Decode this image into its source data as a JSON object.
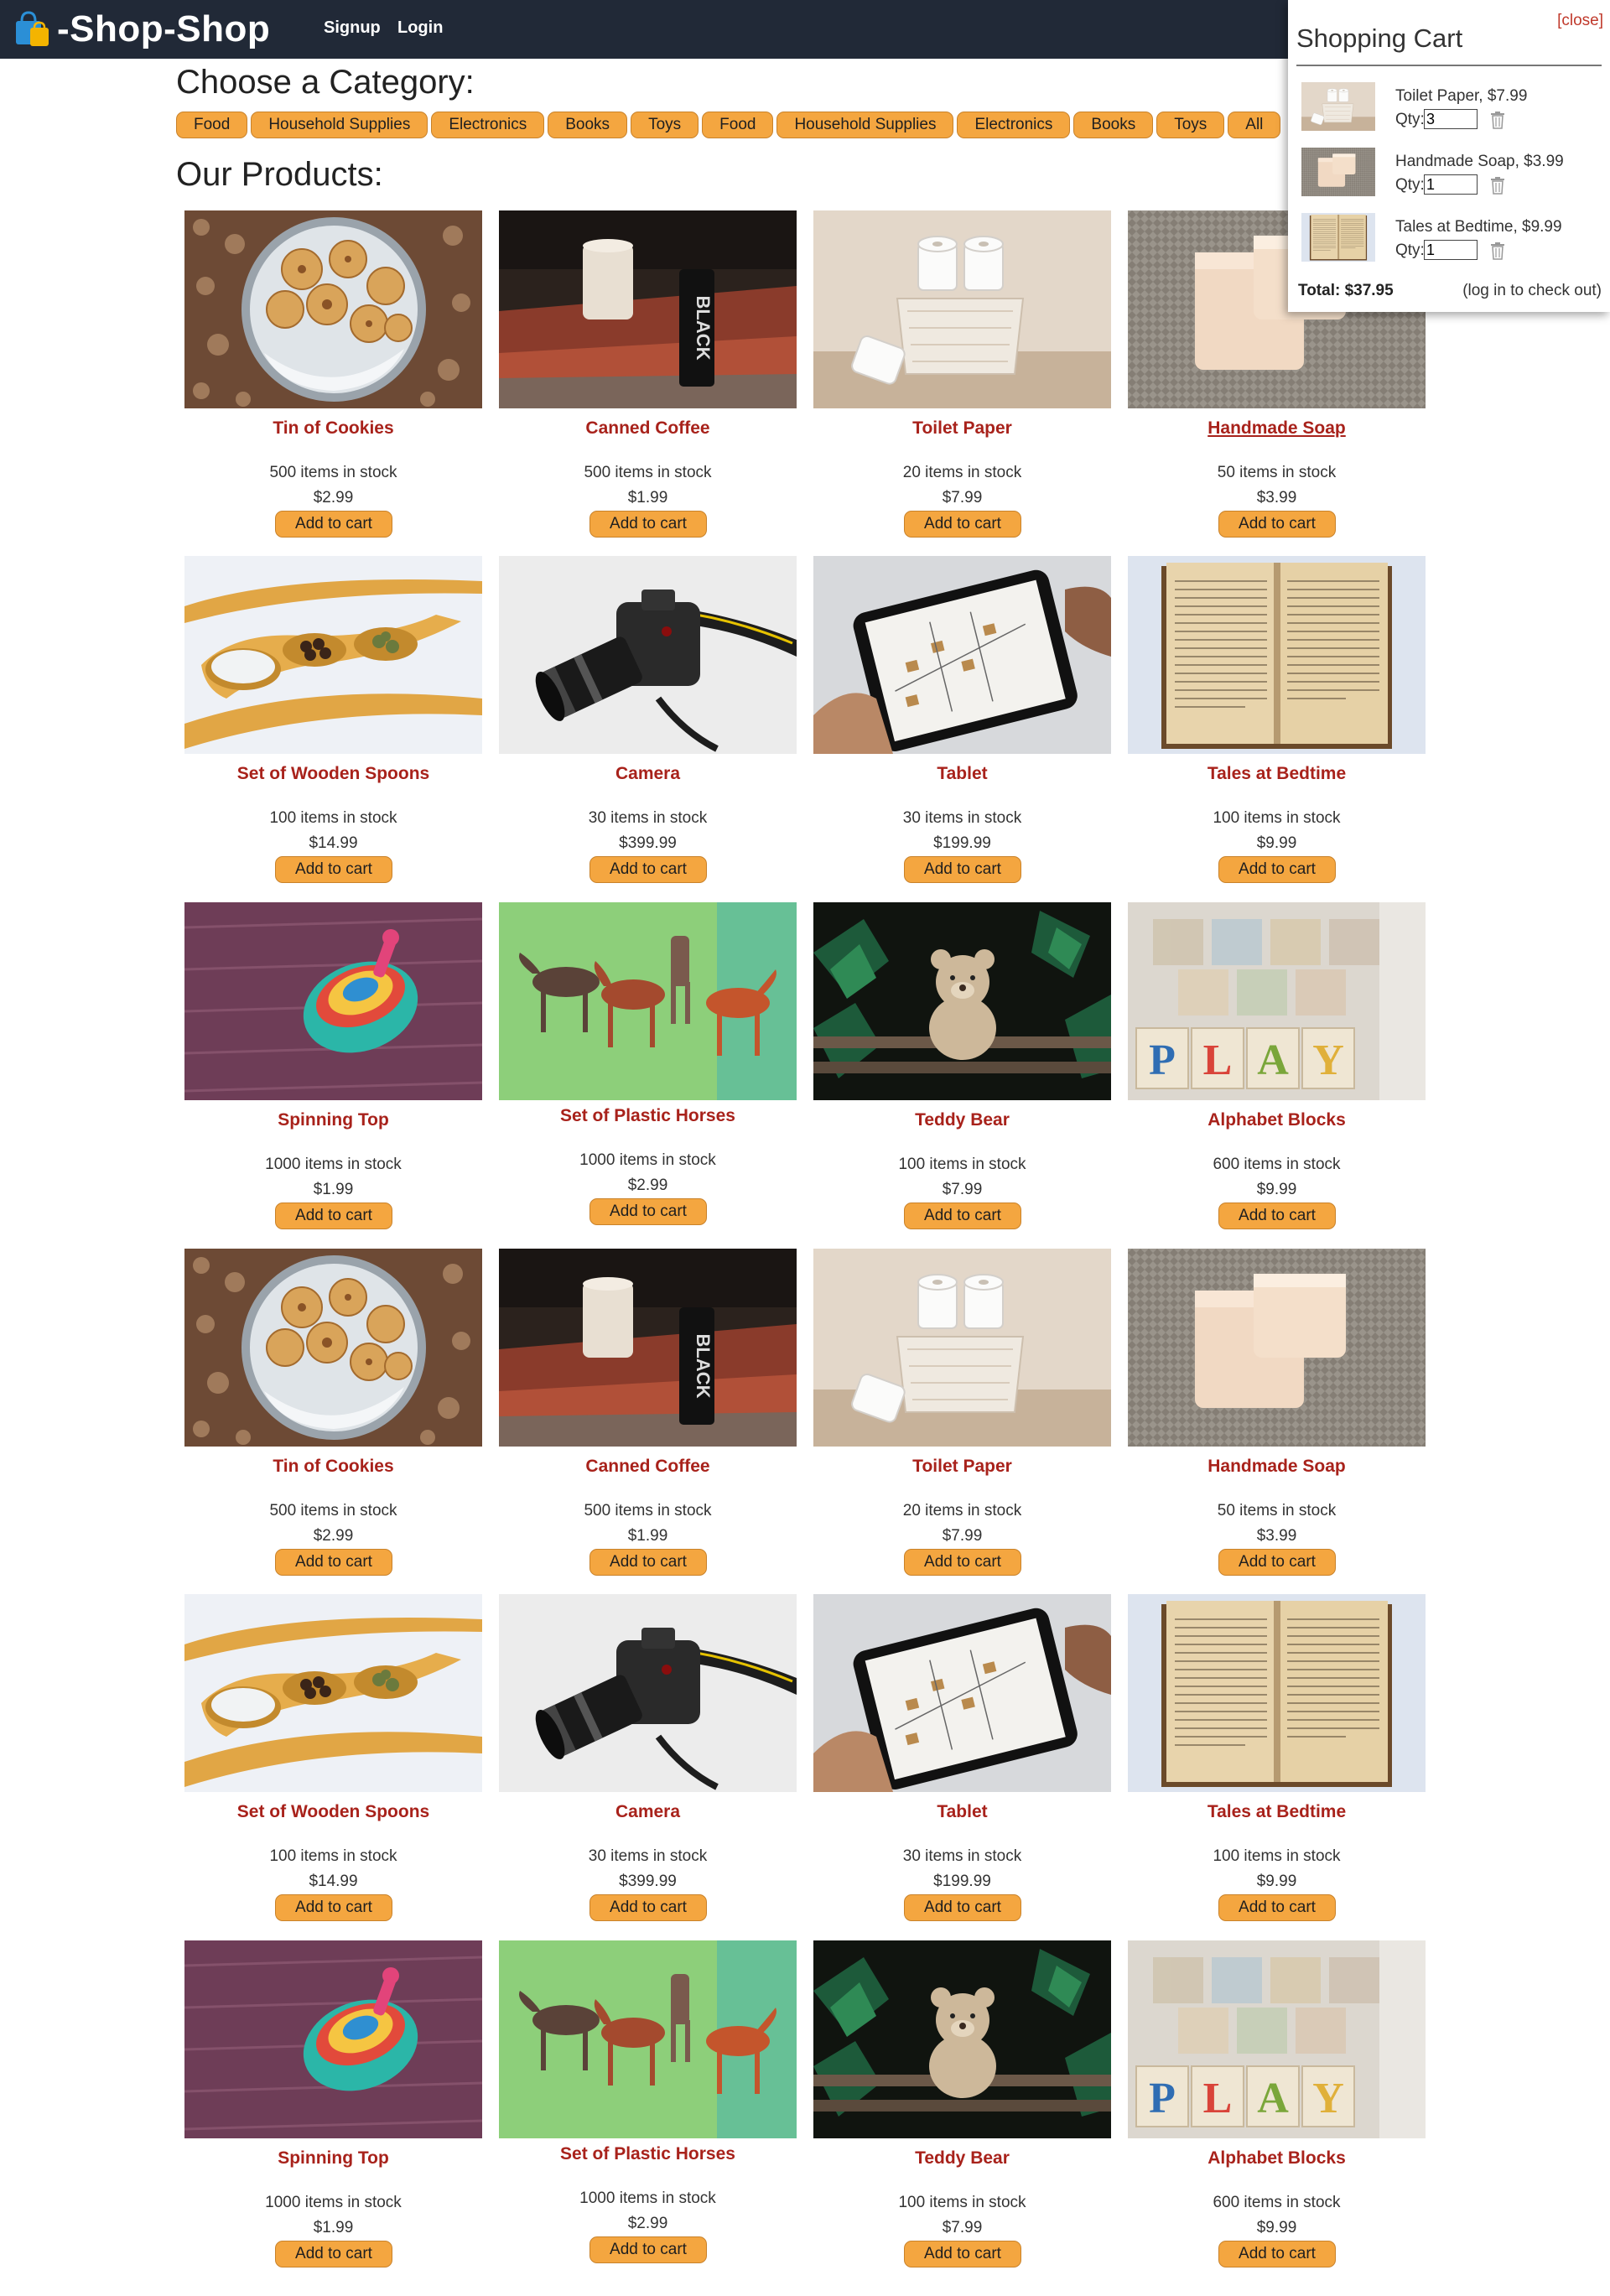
{
  "brand": {
    "name": "-Shop-Shop"
  },
  "nav": {
    "signup": "Signup",
    "login": "Login"
  },
  "headings": {
    "categories": "Choose a Category:",
    "products": "Our Products:"
  },
  "categories": [
    "Food",
    "Household Supplies",
    "Electronics",
    "Books",
    "Toys",
    "Food",
    "Household Supplies",
    "Electronics",
    "Books",
    "Toys",
    "All"
  ],
  "add_label": "Add to cart",
  "products": [
    {
      "name": "Tin of Cookies",
      "stock": "500 items in stock",
      "price": "$2.99",
      "image": "cookies"
    },
    {
      "name": "Canned Coffee",
      "stock": "500 items in stock",
      "price": "$1.99",
      "image": "coffee"
    },
    {
      "name": "Toilet Paper",
      "stock": "20 items in stock",
      "price": "$7.99",
      "image": "toilet-paper"
    },
    {
      "name": "Handmade Soap",
      "stock": "50 items in stock",
      "price": "$3.99",
      "image": "soap"
    },
    {
      "name": "Set of Wooden Spoons",
      "stock": "100 items in stock",
      "price": "$14.99",
      "image": "spoons"
    },
    {
      "name": "Camera",
      "stock": "30 items in stock",
      "price": "$399.99",
      "image": "camera"
    },
    {
      "name": "Tablet",
      "stock": "30 items in stock",
      "price": "$199.99",
      "image": "tablet"
    },
    {
      "name": "Tales at Bedtime",
      "stock": "100 items in stock",
      "price": "$9.99",
      "image": "book"
    },
    {
      "name": "Spinning Top",
      "stock": "1000 items in stock",
      "price": "$1.99",
      "image": "spinning-top"
    },
    {
      "name": "Set of Plastic Horses",
      "stock": "1000 items in stock",
      "price": "$2.99",
      "image": "horses"
    },
    {
      "name": "Teddy Bear",
      "stock": "100 items in stock",
      "price": "$7.99",
      "image": "teddy-bear"
    },
    {
      "name": "Alphabet Blocks",
      "stock": "600 items in stock",
      "price": "$9.99",
      "image": "blocks"
    },
    {
      "name": "Tin of Cookies",
      "stock": "500 items in stock",
      "price": "$2.99",
      "image": "cookies"
    },
    {
      "name": "Canned Coffee",
      "stock": "500 items in stock",
      "price": "$1.99",
      "image": "coffee"
    },
    {
      "name": "Toilet Paper",
      "stock": "20 items in stock",
      "price": "$7.99",
      "image": "toilet-paper"
    },
    {
      "name": "Handmade Soap",
      "stock": "50 items in stock",
      "price": "$3.99",
      "image": "soap"
    },
    {
      "name": "Set of Wooden Spoons",
      "stock": "100 items in stock",
      "price": "$14.99",
      "image": "spoons"
    },
    {
      "name": "Camera",
      "stock": "30 items in stock",
      "price": "$399.99",
      "image": "camera"
    },
    {
      "name": "Tablet",
      "stock": "30 items in stock",
      "price": "$199.99",
      "image": "tablet"
    },
    {
      "name": "Tales at Bedtime",
      "stock": "100 items in stock",
      "price": "$9.99",
      "image": "book"
    },
    {
      "name": "Spinning Top",
      "stock": "1000 items in stock",
      "price": "$1.99",
      "image": "spinning-top"
    },
    {
      "name": "Set of Plastic Horses",
      "stock": "1000 items in stock",
      "price": "$2.99",
      "image": "horses"
    },
    {
      "name": "Teddy Bear",
      "stock": "100 items in stock",
      "price": "$7.99",
      "image": "teddy-bear"
    },
    {
      "name": "Alphabet Blocks",
      "stock": "600 items in stock",
      "price": "$9.99",
      "image": "blocks"
    }
  ],
  "cart": {
    "close": "[close]",
    "title": "Shopping Cart",
    "qty_label": "Qty:",
    "items": [
      {
        "label": "Toilet Paper, $7.99",
        "qty": "3",
        "image": "toilet-paper"
      },
      {
        "label": "Handmade Soap, $3.99",
        "qty": "1",
        "image": "soap"
      },
      {
        "label": "Tales at Bedtime, $9.99",
        "qty": "1",
        "image": "book"
      }
    ],
    "total": "Total: $37.95",
    "login_note": "(log in to check out)"
  },
  "colors": {
    "navbar": "#212937",
    "accent": "#f4a640",
    "product_name": "#a8221b",
    "close": "#c0392b"
  }
}
